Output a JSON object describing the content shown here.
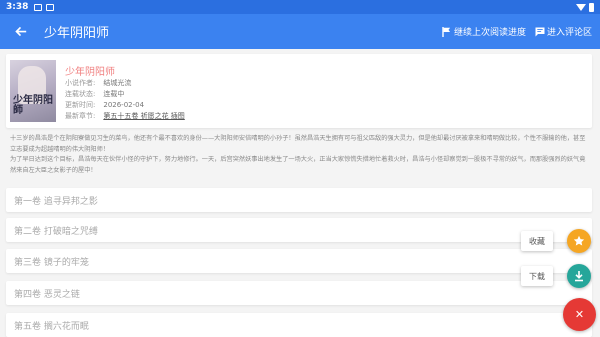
{
  "status_bar": {
    "time": "3:38"
  },
  "app_bar": {
    "title": "少年阴阳师",
    "continue_label": "继续上次阅读进度",
    "comments_label": "进入评论区"
  },
  "book": {
    "title": "少年阴阳师",
    "cover_text": "少年阴阳師",
    "author_label": "小说作者:",
    "author": "结城光流",
    "status_label": "连载状态:",
    "status": "连载中",
    "updated_label": "更新时间:",
    "updated": "2026-02-04",
    "latest_label": "最新章节:",
    "latest": "第五十五卷 祈愿之花 插图"
  },
  "synopsis": [
    "十三岁的昌浩是个在阴阳寮做见习生的菜鸟，他还有个最不喜欢的身份——大阴阳师安倍晴明的小孙子！虽然昌浩天生拥有可与祖父匹敌的强大灵力，但是他却最讨厌被拿来和晴明做比较，个性不服输的他，甚至立志要成为超越晴明的伟大阴阳师！",
    "为了早日达到这个目标，昌浩每天在伙伴小怪的守护下，努力地修行。一天，后宫突然妖事出地发生了一场大火，正当大家惊慌失措地忙着救火时，昌浩与小怪却察觉到一股极不寻常的妖气，而那股强烈的妖气竟然来自左大臣之女影子的屋中！"
  ],
  "volumes": [
    {
      "label": "第一卷 追寻异邦之影"
    },
    {
      "label": "第二卷 打破暗之咒缚"
    },
    {
      "label": "第三卷 镜子的牢笼"
    },
    {
      "label": "第四卷 恶灵之链"
    },
    {
      "label": "第五卷 搁六花而眠"
    }
  ],
  "fab": {
    "favorite_label": "收藏",
    "download_label": "下载",
    "close_symbol": "✕"
  },
  "colors": {
    "status_bar": "#2b6fe0",
    "app_bar": "#3b82f0",
    "book_title": "#f08080",
    "fab_favorite": "#f5a623",
    "fab_download": "#26a69a",
    "fab_main": "#e53935"
  },
  "icons": {
    "back": "arrow-left-icon",
    "continue": "flag-icon",
    "comments": "comment-icon",
    "favorite": "star-icon",
    "download": "download-icon",
    "close": "close-icon"
  }
}
